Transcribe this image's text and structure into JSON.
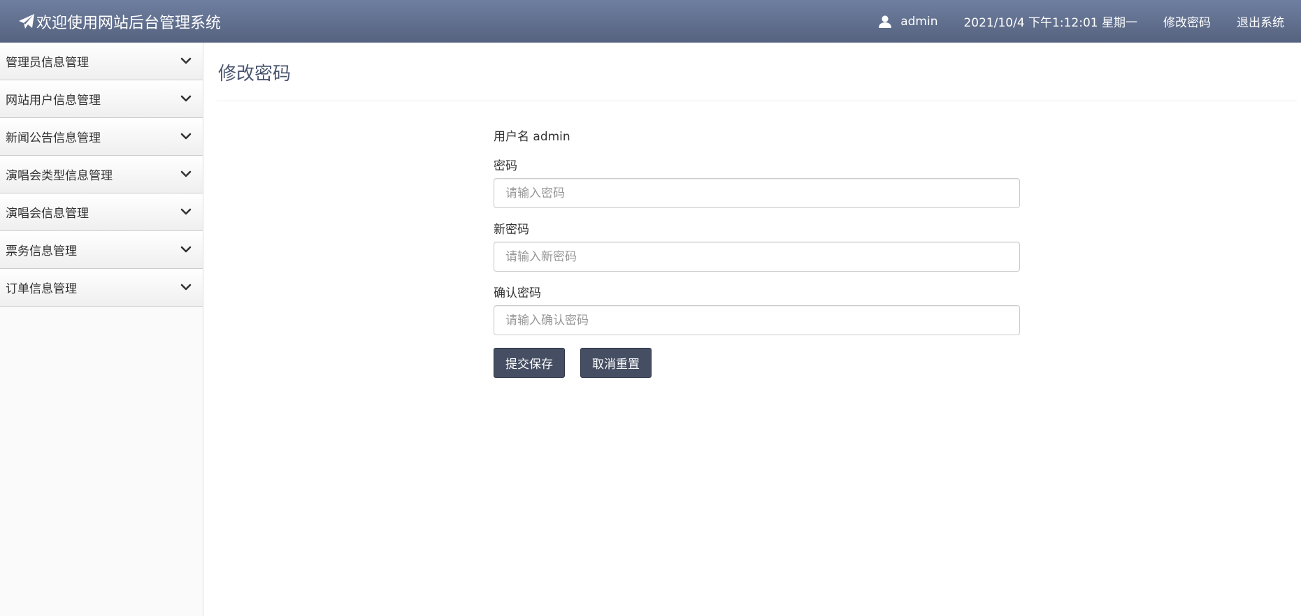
{
  "header": {
    "brand_icon": "paper-plane-icon",
    "title": "欢迎使用网站后台管理系统",
    "user_icon": "user-icon",
    "username": "admin",
    "datetime": "2021/10/4 下午1:12:01 星期一",
    "change_password": "修改密码",
    "logout": "退出系统"
  },
  "sidebar": {
    "chevron_icon": "chevron-down-icon",
    "items": [
      {
        "label": "管理员信息管理"
      },
      {
        "label": "网站用户信息管理"
      },
      {
        "label": "新闻公告信息管理"
      },
      {
        "label": "演唱会类型信息管理"
      },
      {
        "label": "演唱会信息管理"
      },
      {
        "label": "票务信息管理"
      },
      {
        "label": "订单信息管理"
      }
    ]
  },
  "main": {
    "page_title": "修改密码",
    "form": {
      "username_label": "用户名",
      "username_value": "admin",
      "password": {
        "label": "密码",
        "placeholder": "请输入密码",
        "value": ""
      },
      "new_password": {
        "label": "新密码",
        "placeholder": "请输入新密码",
        "value": ""
      },
      "confirm_password": {
        "label": "确认密码",
        "placeholder": "请输入确认密码",
        "value": ""
      },
      "submit_label": "提交保存",
      "reset_label": "取消重置"
    }
  },
  "colors": {
    "header_top": "#6f7fa0",
    "header_bottom": "#55627f",
    "title": "#4a5670",
    "button": "#454e62"
  }
}
